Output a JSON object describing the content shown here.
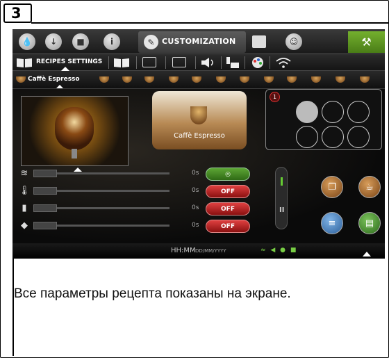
{
  "step": {
    "number": "3"
  },
  "top_tabs": {
    "active_label": "CUSTOMIZATION",
    "icons": [
      "water-drop-icon",
      "download-icon",
      "cup-icon",
      "info-icon",
      "pencil-icon",
      "grid-icon",
      "user-icon",
      "wrench-icon"
    ]
  },
  "sub_tabs": {
    "recipes_label": "RECIPES SETTINGS"
  },
  "recipe_strip": {
    "selected": "Caffè Espresso"
  },
  "card": {
    "label": "Caffè Espresso"
  },
  "grid": {
    "badge": "1"
  },
  "controls": {
    "rows": [
      {
        "icon": "flow-icon",
        "value": "0s",
        "toggle": "",
        "toggle_icon": "location-pin-icon"
      },
      {
        "icon": "thermometer-icon",
        "value": "0s",
        "toggle": "OFF"
      },
      {
        "icon": "milk-bottle-icon",
        "value": "0s",
        "toggle": "OFF"
      },
      {
        "icon": "grinder-icon",
        "value": "0s",
        "toggle": "OFF"
      }
    ]
  },
  "status": {
    "time": "HH:MM",
    "date": "DD/MM/YYYY"
  },
  "colors": {
    "accent_green": "#5da635",
    "off_red": "#c02525",
    "screen_bg": "#0c0c0c"
  },
  "caption": "Все параметры рецепта показаны на экране."
}
